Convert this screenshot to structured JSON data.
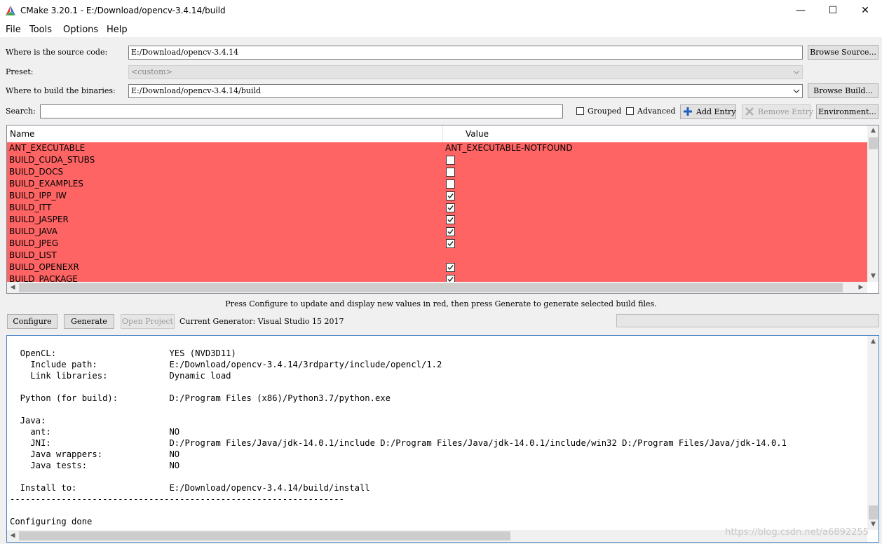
{
  "window": {
    "title": "CMake 3.20.1 - E:/Download/opencv-3.4.14/build",
    "minimize_glyph": "—",
    "maximize_glyph": "☐",
    "close_glyph": "✕"
  },
  "menu": [
    "File",
    "Tools",
    "Options",
    "Help"
  ],
  "source": {
    "label": "Where is the source code:",
    "value": "E:/Download/opencv-3.4.14",
    "browse": "Browse Source..."
  },
  "preset": {
    "label": "Preset:",
    "value": "<custom>"
  },
  "binaries": {
    "label": "Where to build the binaries:",
    "value": "E:/Download/opencv-3.4.14/build",
    "browse": "Browse Build..."
  },
  "search": {
    "label": "Search:",
    "value": ""
  },
  "options": {
    "grouped": "Grouped",
    "advanced": "Advanced",
    "add_entry": "Add Entry",
    "remove_entry": "Remove Entry",
    "environment": "Environment..."
  },
  "table": {
    "headers": [
      "Name",
      "Value"
    ],
    "row_color": "#ff6464",
    "rows": [
      {
        "name": "ANT_EXECUTABLE",
        "value": "ANT_EXECUTABLE-NOTFOUND"
      },
      {
        "name": "BUILD_CUDA_STUBS",
        "checked": false
      },
      {
        "name": "BUILD_DOCS",
        "checked": false
      },
      {
        "name": "BUILD_EXAMPLES",
        "checked": false
      },
      {
        "name": "BUILD_IPP_IW",
        "checked": true
      },
      {
        "name": "BUILD_ITT",
        "checked": true
      },
      {
        "name": "BUILD_JASPER",
        "checked": true
      },
      {
        "name": "BUILD_JAVA",
        "checked": true
      },
      {
        "name": "BUILD_JPEG",
        "checked": true
      },
      {
        "name": "BUILD_LIST",
        "value": ""
      },
      {
        "name": "BUILD_OPENEXR",
        "checked": true
      },
      {
        "name": "BUILD_PACKAGE",
        "checked": true
      }
    ]
  },
  "hint": "Press Configure to update and display new values in red, then press Generate to generate selected build files.",
  "actions": {
    "configure": "Configure",
    "generate": "Generate",
    "open_project": "Open Project",
    "generator": "Current Generator: Visual Studio 15 2017"
  },
  "output": {
    "lines": [
      "  OpenCL:                      YES (NVD3D11)",
      "    Include path:              E:/Download/opencv-3.4.14/3rdparty/include/opencl/1.2",
      "    Link libraries:            Dynamic load",
      "",
      "  Python (for build):          D:/Program Files (x86)/Python3.7/python.exe",
      "",
      "  Java:",
      "    ant:                       NO",
      "    JNI:                       D:/Program Files/Java/jdk-14.0.1/include D:/Program Files/Java/jdk-14.0.1/include/win32 D:/Program Files/Java/jdk-14.0.1",
      "    Java wrappers:             NO",
      "    Java tests:                NO",
      "",
      "  Install to:                  E:/Download/opencv-3.4.14/build/install",
      "-----------------------------------------------------------------",
      "",
      "Configuring done"
    ]
  },
  "watermark": "https://blog.csdn.net/a6892255"
}
